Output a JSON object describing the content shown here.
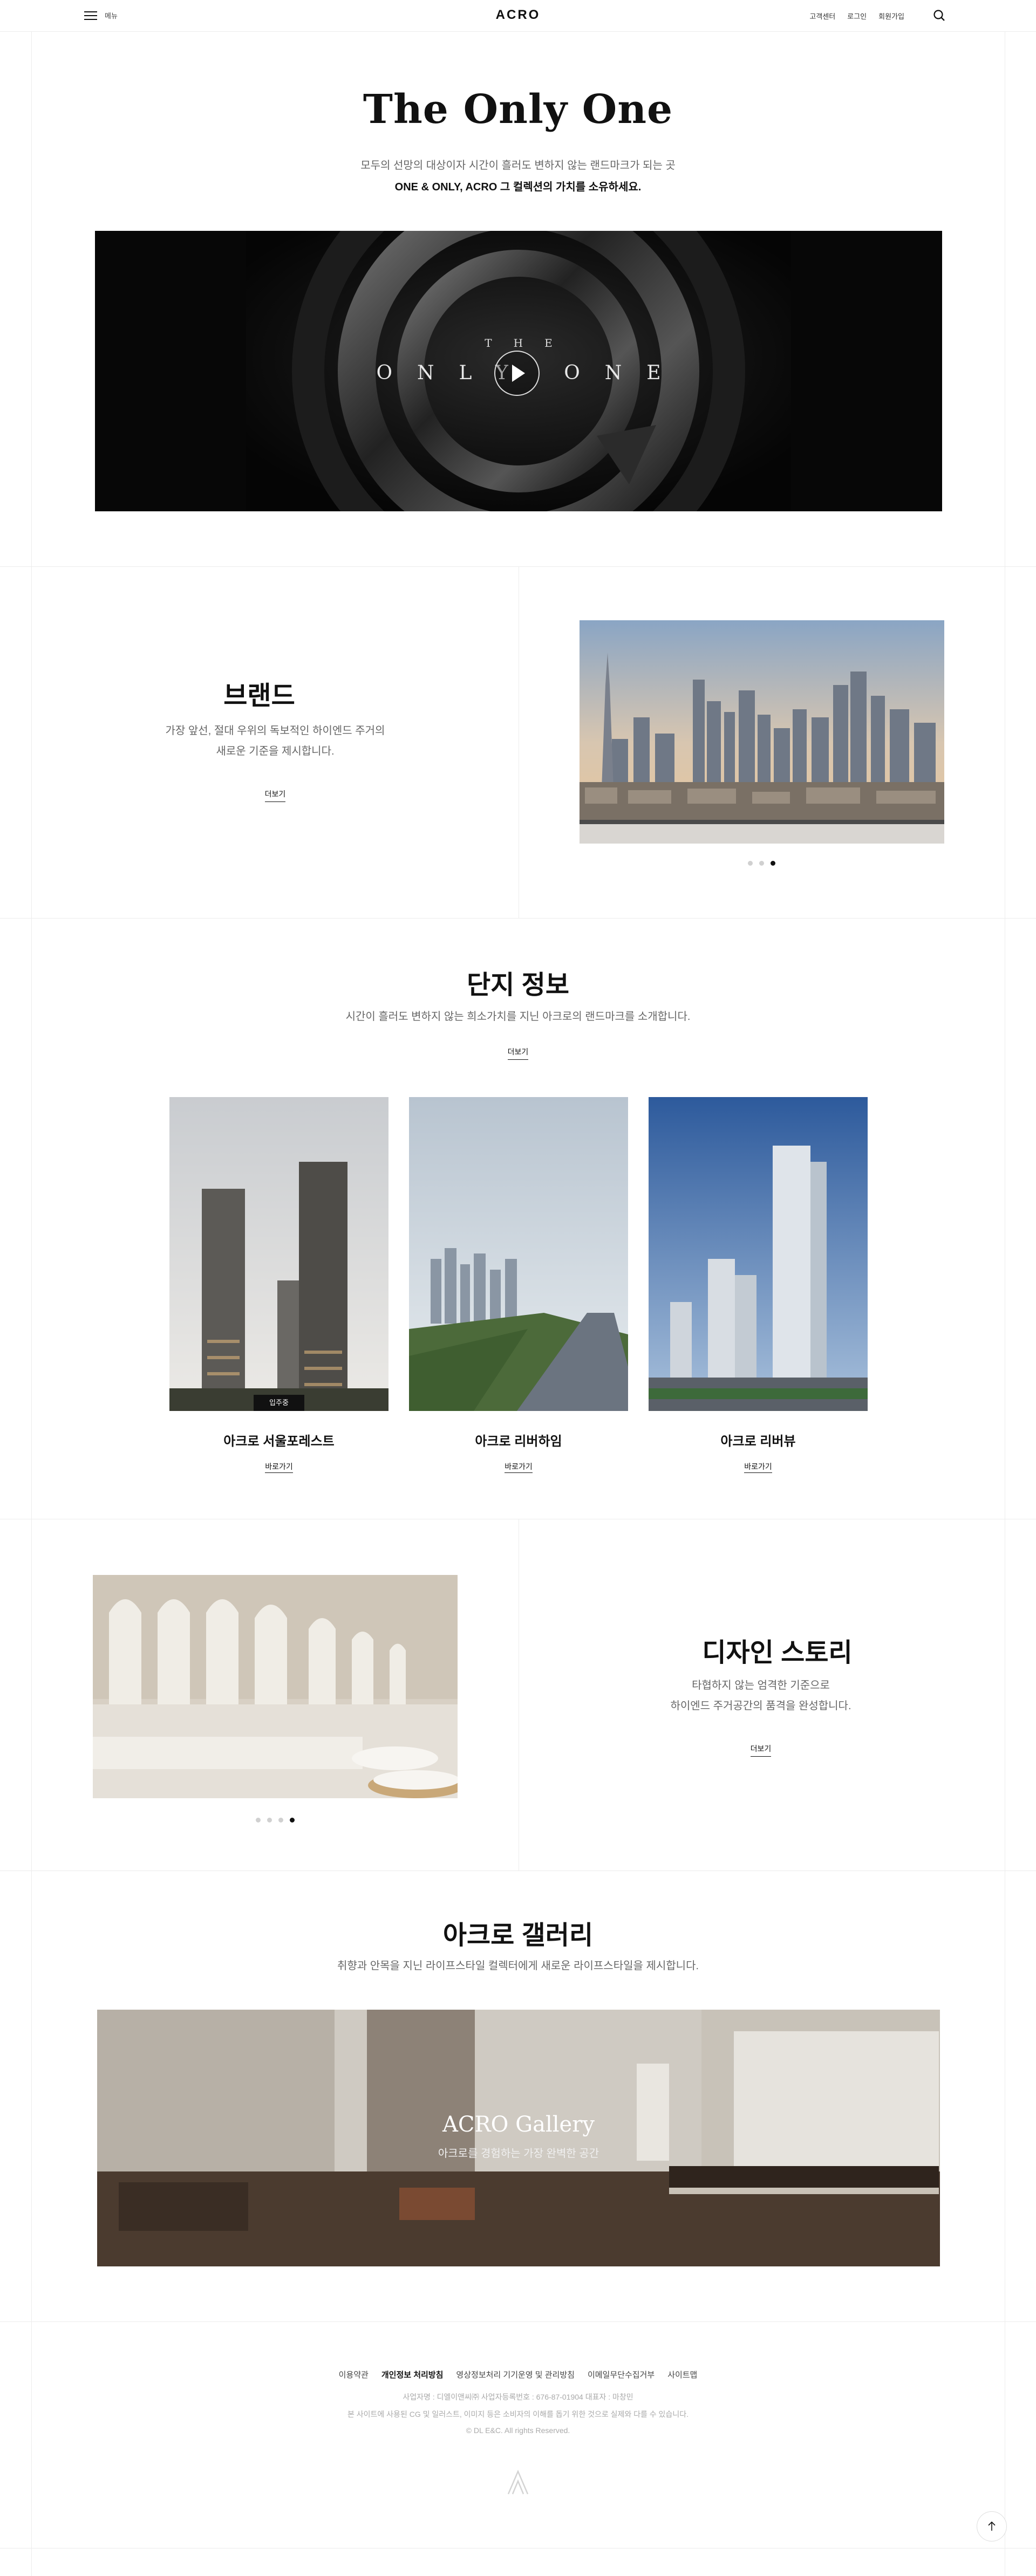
{
  "header": {
    "menu_label": "메뉴",
    "logo": "ACRO",
    "util_links": [
      "고객센터",
      "로그인",
      "회원가입"
    ]
  },
  "hero": {
    "title": "The Only One",
    "subtitle1": "모두의 선망의 대상이자 시간이 흘러도 변하지 않는 랜드마크가 되는 곳",
    "subtitle2": "ONE & ONLY, ACRO 그 컬렉션의 가치를 소유하세요.",
    "video_small": "THE",
    "video_big": "ONLY ONE"
  },
  "brand": {
    "title": "브랜드",
    "desc1": "가장 앞선, 절대 우위의 독보적인 하이엔드 주거의",
    "desc2": "새로운 기준을 제시합니다.",
    "more": "더보기",
    "slide_count": 3,
    "active_slide": 3
  },
  "complex": {
    "title": "단지 정보",
    "desc": "시간이 흘러도 변하지 않는 희소가치를 지닌 아크로의 랜드마크를 소개합니다.",
    "more": "더보기",
    "cards": [
      {
        "name": "아크로 서울포레스트",
        "link": "바로가기",
        "badge": "입주중"
      },
      {
        "name": "아크로 리버하임",
        "link": "바로가기"
      },
      {
        "name": "아크로 리버뷰",
        "link": "바로가기"
      }
    ]
  },
  "design": {
    "title": "디자인 스토리",
    "desc1": "타협하지 않는 엄격한 기준으로",
    "desc2": "하이엔드 주거공간의 품격을 완성합니다.",
    "more": "더보기",
    "slide_count": 4,
    "active_slide": 4
  },
  "gallery": {
    "title": "아크로 갤러리",
    "desc": "취향과 안목을 지닌 라이프스타일 컬렉터에게 새로운 라이프스타일을 제시합니다.",
    "banner_title": "ACRO Gallery",
    "banner_sub": "아크로를 경험하는 가장 완벽한 공간"
  },
  "footer": {
    "links": [
      "이용약관",
      "개인정보 처리방침",
      "영상정보처리 기기운영 및 관리방침",
      "이메일무단수집거부",
      "사이트맵"
    ],
    "info1": "사업자명 : 디엘이앤씨㈜     사업자등록번호 : 676-87-01904     대표자 : 마창민",
    "info2": "본 사이트에 사용된 CG 및 일러스트, 이미지 등은 소비자의 이해를 돕기 위한 것으로 실제와 다를 수 있습니다.",
    "copyright": "© DL E&C. All rights Reserved."
  },
  "colors": {
    "background": "#ffffff",
    "text": "#111111",
    "muted": "#666666",
    "line": "#ececec"
  }
}
